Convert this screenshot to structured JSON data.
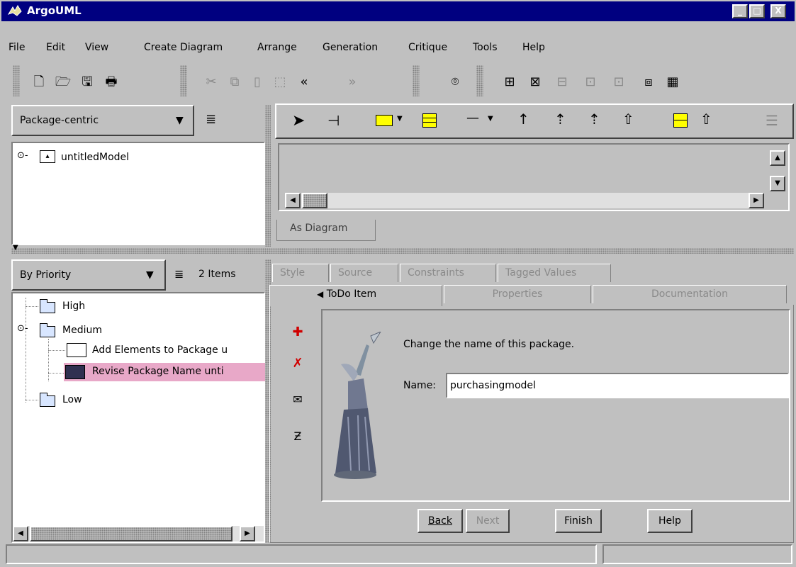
{
  "window": {
    "title": "ArgoUML",
    "minimize": "_",
    "maximize": "□",
    "close": "X"
  },
  "menu": [
    "File",
    "Edit",
    "View",
    "Create Diagram",
    "Arrange",
    "Generation",
    "Critique",
    "Tools",
    "Help"
  ],
  "explorer": {
    "perspective": "Package-centric",
    "tree_root": "untitledModel"
  },
  "diagram": {
    "tab_label": "As Diagram"
  },
  "todo": {
    "sort": "By Priority",
    "count": "2 Items",
    "groups": {
      "high": "High",
      "medium": "Medium",
      "low": "Low"
    },
    "items": [
      "Add Elements to Package u",
      "Revise Package Name unti"
    ]
  },
  "details": {
    "tabs_back": [
      "Style",
      "Source",
      "Constraints",
      "Tagged Values"
    ],
    "tabs_front": [
      "ToDo Item",
      "Properties",
      "Documentation"
    ],
    "active_tab_arrow": "◀",
    "message": "Change the name of this package.",
    "name_label": "Name:",
    "name_value": "purchasingmodel",
    "buttons": {
      "back": "Back",
      "next": "Next",
      "finish": "Finish",
      "help": "Help"
    }
  },
  "icons": {
    "toolbar_main": [
      "new-file-icon",
      "open-icon",
      "save-icon",
      "print-icon",
      "cut-icon",
      "copy-icon",
      "paste-icon",
      "delete-icon",
      "back-icon",
      "forward-icon",
      "find-icon"
    ],
    "toolbar_diagrams": [
      "class-diagram-icon",
      "usecase-diagram-icon",
      "state-diagram-icon",
      "activity-diagram-icon",
      "collaboration-diagram-icon",
      "deployment-diagram-icon",
      "sequence-diagram-icon"
    ]
  },
  "colors": {
    "titlebar": "#000080",
    "selected_item": "#e8a8c8",
    "window_bg": "#c0c0c0",
    "uml_yellow": "#ffff00"
  }
}
